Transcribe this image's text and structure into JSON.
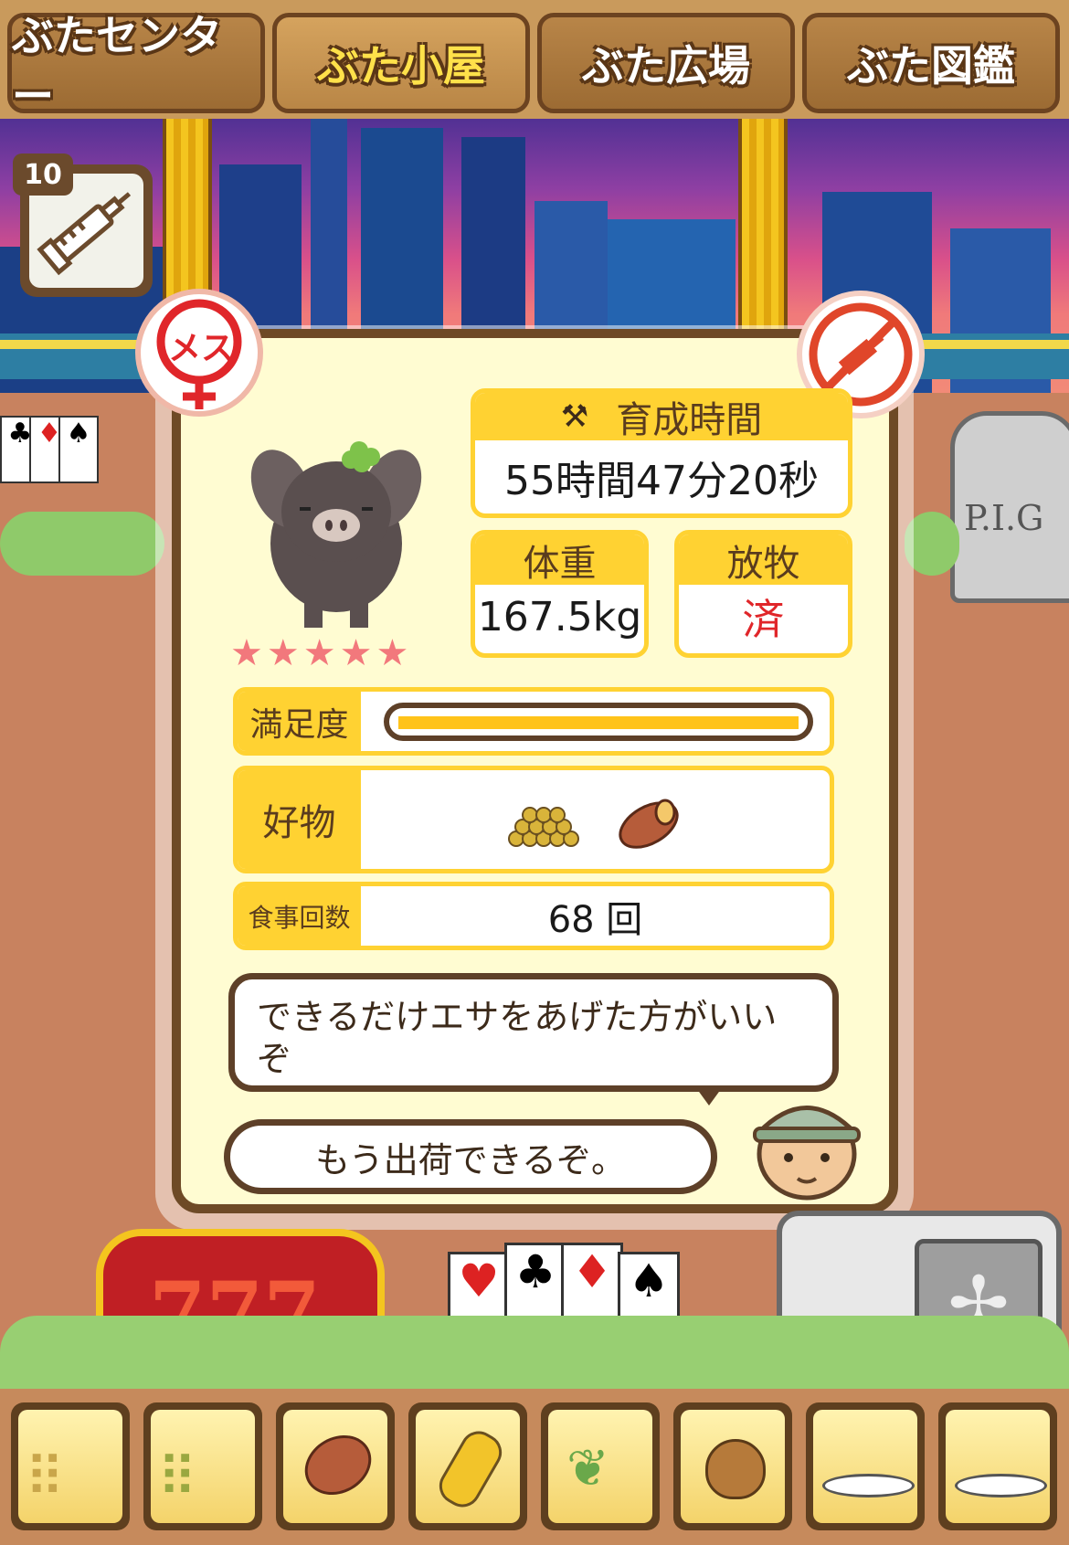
{
  "nav": {
    "tabs": [
      {
        "label": "ぶたセンター",
        "active": false
      },
      {
        "label": "ぶた小屋",
        "active": true
      },
      {
        "label": "ぶた広場",
        "active": false
      },
      {
        "label": "ぶた図鑑",
        "active": false
      }
    ]
  },
  "item": {
    "count": "10",
    "icon": "syringe-icon"
  },
  "pig": {
    "gender_label": "メス",
    "stars": "★★★★★",
    "star_rating": 5
  },
  "stats": {
    "raise_time": {
      "label": "育成時間",
      "value": "55時間47分20秒"
    },
    "weight": {
      "label": "体重",
      "value": "167.5kg"
    },
    "grazing": {
      "label": "放牧",
      "value": "済"
    }
  },
  "rows": {
    "satisfaction": {
      "label": "満足度",
      "level": 1.0
    },
    "favorite": {
      "label": "好物",
      "items": [
        "grain-icon",
        "sweet-potato-icon"
      ]
    },
    "meals": {
      "label": "食事回数",
      "value": "68 回"
    }
  },
  "messages": {
    "advice": "できるだけエサをあげた方がいいぞ",
    "status": "もう出荷できるぞ。"
  },
  "decor": {
    "sign_text": "P.I.G",
    "slot_text": "777"
  },
  "feed_bar": [
    "grain-icon",
    "mixed-grain-icon",
    "sweet-potato-icon",
    "corn-icon",
    "beans-leaf-icon",
    "acorn-icon",
    "grain-plate-icon",
    "meatball-plate-icon"
  ],
  "colors": {
    "accent": "#ffd232",
    "panel": "#fffcd2",
    "grazing_done": "#e0262a",
    "border": "#6e4a26"
  }
}
